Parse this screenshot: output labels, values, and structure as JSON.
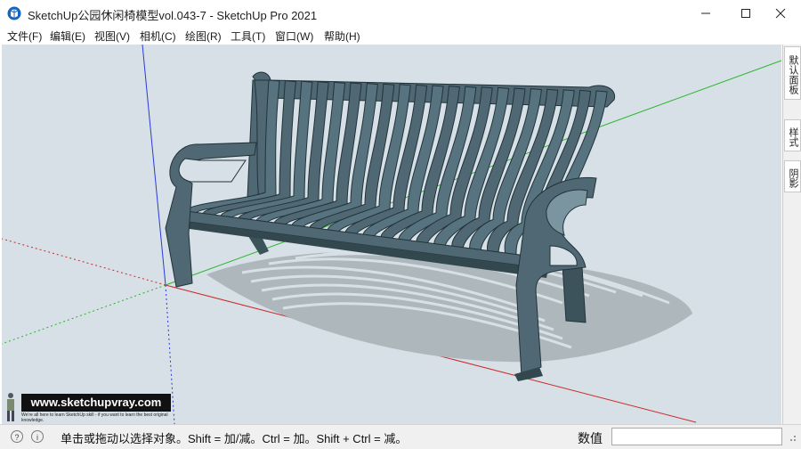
{
  "window": {
    "title": "SketchUp公园休闲椅模型vol.043-7 - SketchUp Pro 2021",
    "app_icon": "sketchup-logo-icon"
  },
  "menu": {
    "items": [
      {
        "label": "文件(F)"
      },
      {
        "label": "编辑(E)"
      },
      {
        "label": "视图(V)"
      },
      {
        "label": "相机(C)"
      },
      {
        "label": "绘图(R)"
      },
      {
        "label": "工具(T)"
      },
      {
        "label": "窗口(W)"
      },
      {
        "label": "帮助(H)"
      }
    ]
  },
  "tray": {
    "tabs": [
      {
        "label": "默认面板"
      },
      {
        "label": "样式"
      },
      {
        "label": "阴影"
      }
    ]
  },
  "watermark": {
    "url": "www.sketchupvray.com",
    "tagline": "We're all here to learn SketchUp skill - if you want to learn the best original knowledge."
  },
  "status": {
    "hint": "单击或拖动以选择对象。Shift = 加/减。Ctrl = 加。Shift + Ctrl = 减。",
    "vcb_label": "数值",
    "vcb_value": ""
  },
  "colors": {
    "viewport_bg": "#d6e0e6",
    "bench": "#4f6873",
    "bench_highlight": "#7a959f",
    "bench_dark": "#33474f",
    "shadow": "#aeb7bc",
    "axis_red": "#cc2a2a",
    "axis_green": "#28b428",
    "axis_blue": "#2a3ad6"
  }
}
